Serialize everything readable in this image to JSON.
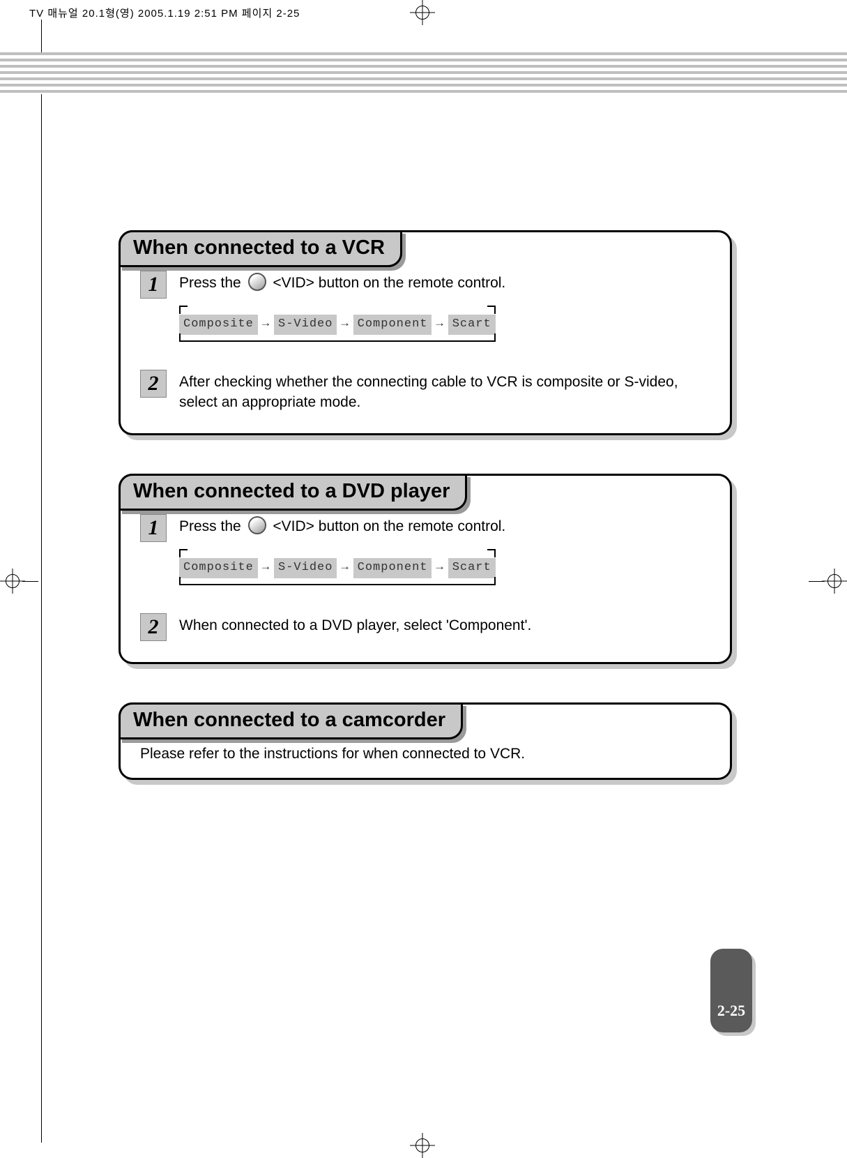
{
  "header_meta": "TV 매뉴얼 20.1형(영)  2005.1.19 2:51 PM  페이지 2-25",
  "page_number": "2-25",
  "cycle_items": [
    "Composite",
    "S-Video",
    "Component",
    "Scart"
  ],
  "arrow": "→",
  "sections": [
    {
      "title": "When connected to a VCR",
      "steps": [
        {
          "num": "1",
          "text_pre": "Press the ",
          "text_post": " <VID> button on the remote control.",
          "has_button": true,
          "has_cycle": true
        },
        {
          "num": "2",
          "text_full": "After checking whether the connecting cable to VCR is composite or S-video, select an appropriate mode.",
          "has_button": false,
          "has_cycle": false
        }
      ]
    },
    {
      "title": "When connected to a DVD player",
      "steps": [
        {
          "num": "1",
          "text_pre": "Press the ",
          "text_post": " <VID> button on the remote control.",
          "has_button": true,
          "has_cycle": true
        },
        {
          "num": "2",
          "text_full": "When connected to a DVD player, select 'Component'.",
          "has_button": false,
          "has_cycle": false
        }
      ]
    },
    {
      "title": "When connected to a camcorder",
      "plain_text": "Please refer to the instructions for when connected to VCR."
    }
  ]
}
